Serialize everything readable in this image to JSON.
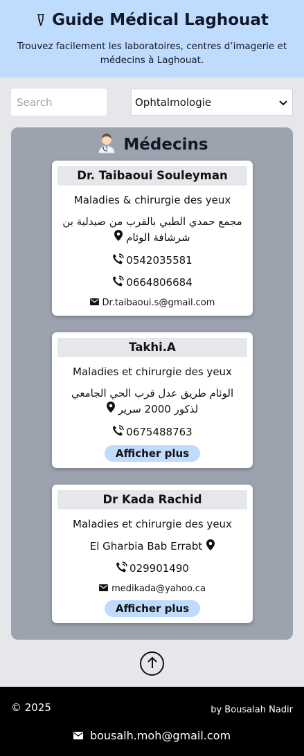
{
  "header": {
    "title": "Guide Médical Laghouat",
    "subtitle": "Trouvez facilement les laboratoires, centres d’imagerie et médecins à Laghouat.",
    "icon": "medical-tube-icon"
  },
  "search": {
    "placeholder": "Search",
    "value": ""
  },
  "specialty_select": {
    "selected": "Ophtalmologie"
  },
  "section": {
    "title": "Médecins",
    "icon": "doctor-icon"
  },
  "doctors": [
    {
      "name": "Dr. Taibaoui Souleyman",
      "specialty": "Maladies & chirurgie des yeux",
      "address": "مجمع حمدي الطبي بالقرب من صيدلية بن شرشافة الوئام",
      "phones": [
        "0542035581",
        "0664806684"
      ],
      "email": "Dr.taibaoui.s@gmail.com"
    },
    {
      "name": "Takhi.A",
      "specialty": "Maladies et chirurgie des yeux",
      "address": "الوئام طريق عدل قرب الحي الجامعي لذكور 2000 سرير",
      "phones": [
        "0675488763"
      ],
      "more_label": "Afficher plus"
    },
    {
      "name": "Dr Kada Rachid",
      "specialty": "Maladies et chirurgie des yeux",
      "address": "El Gharbia Bab Errabt",
      "phones": [
        "029901490"
      ],
      "email": "medikada@yahoo.ca",
      "more_label": "Afficher plus"
    }
  ],
  "footer": {
    "copyright": "© 2025",
    "author": "by Bousalah Nadir",
    "email": "bousalh.moh@gmail.com"
  },
  "colors": {
    "header_bg": "#bfdbfe",
    "panel_bg": "#9ca3af",
    "page_bg": "#e5e7eb",
    "button_bg": "#bfdbfe",
    "footer_bg": "#000000"
  }
}
